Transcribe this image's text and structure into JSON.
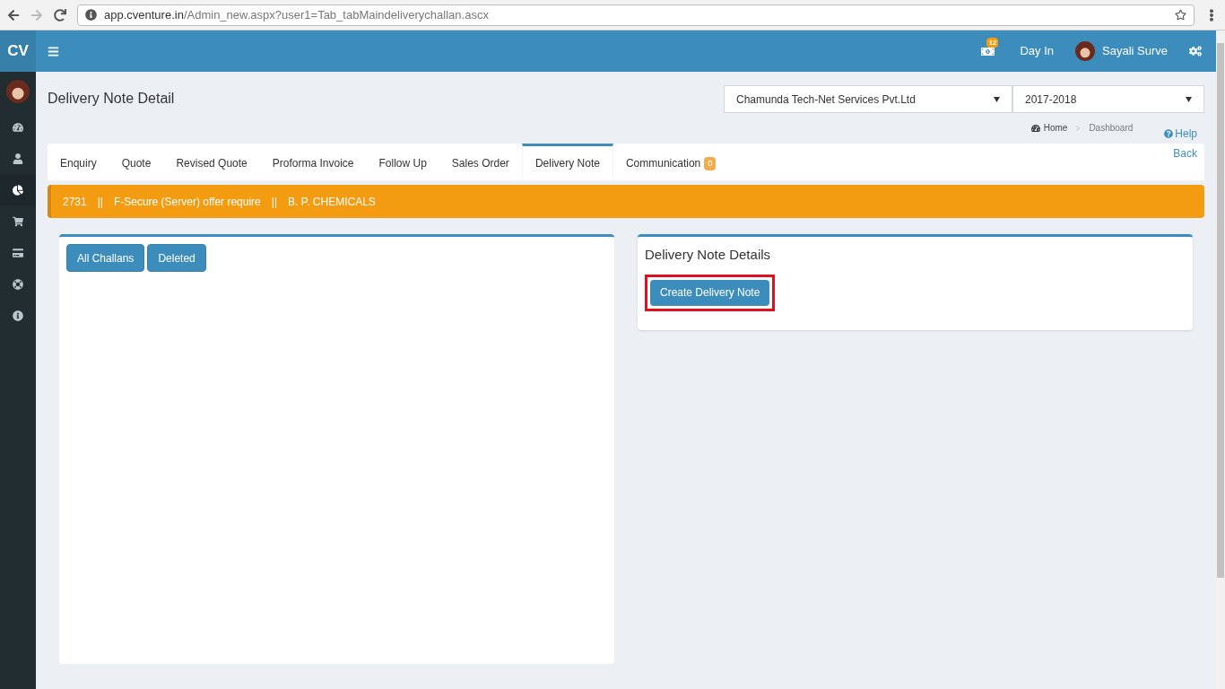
{
  "browser": {
    "url_host": "app.cventure.in",
    "url_path": "/Admin_new.aspx?user1=Tab_tabMaindeliverychallan.ascx"
  },
  "header": {
    "logo": "CV",
    "notification_count": "12",
    "day_in": "Day In",
    "user_name": "Sayali Surve"
  },
  "sidebar": {
    "items": [
      {
        "selected": false
      },
      {
        "selected": false
      },
      {
        "selected": true
      },
      {
        "selected": false
      },
      {
        "selected": false
      },
      {
        "selected": false
      },
      {
        "selected": false
      }
    ]
  },
  "page": {
    "title": "Delivery Note Detail",
    "company_select": "Chamunda Tech-Net Services Pvt.Ltd",
    "year_select": "2017-2018",
    "breadcrumb": [
      "Home",
      "Dashboard"
    ],
    "help": "Help"
  },
  "tabs": [
    {
      "label": "Enquiry",
      "selected": false
    },
    {
      "label": "Quote",
      "selected": false
    },
    {
      "label": "Revised Quote",
      "selected": false
    },
    {
      "label": "Proforma Invoice",
      "selected": false
    },
    {
      "label": "Follow Up",
      "selected": false
    },
    {
      "label": "Sales Order",
      "selected": false
    },
    {
      "label": "Delivery Note",
      "selected": true
    },
    {
      "label": "Communication",
      "selected": false,
      "badge": "0"
    }
  ],
  "back": "Back",
  "info_bar": [
    "2731",
    "||",
    "F-Secure (Server) offer require",
    "||",
    "B. P. CHEMICALS"
  ],
  "left_panel": {
    "buttons": [
      "All Challans",
      "Deleted"
    ]
  },
  "right_panel": {
    "title": "Delivery Note Details",
    "button": {
      "label": "Create Delivery Note",
      "highlighted": true
    }
  }
}
